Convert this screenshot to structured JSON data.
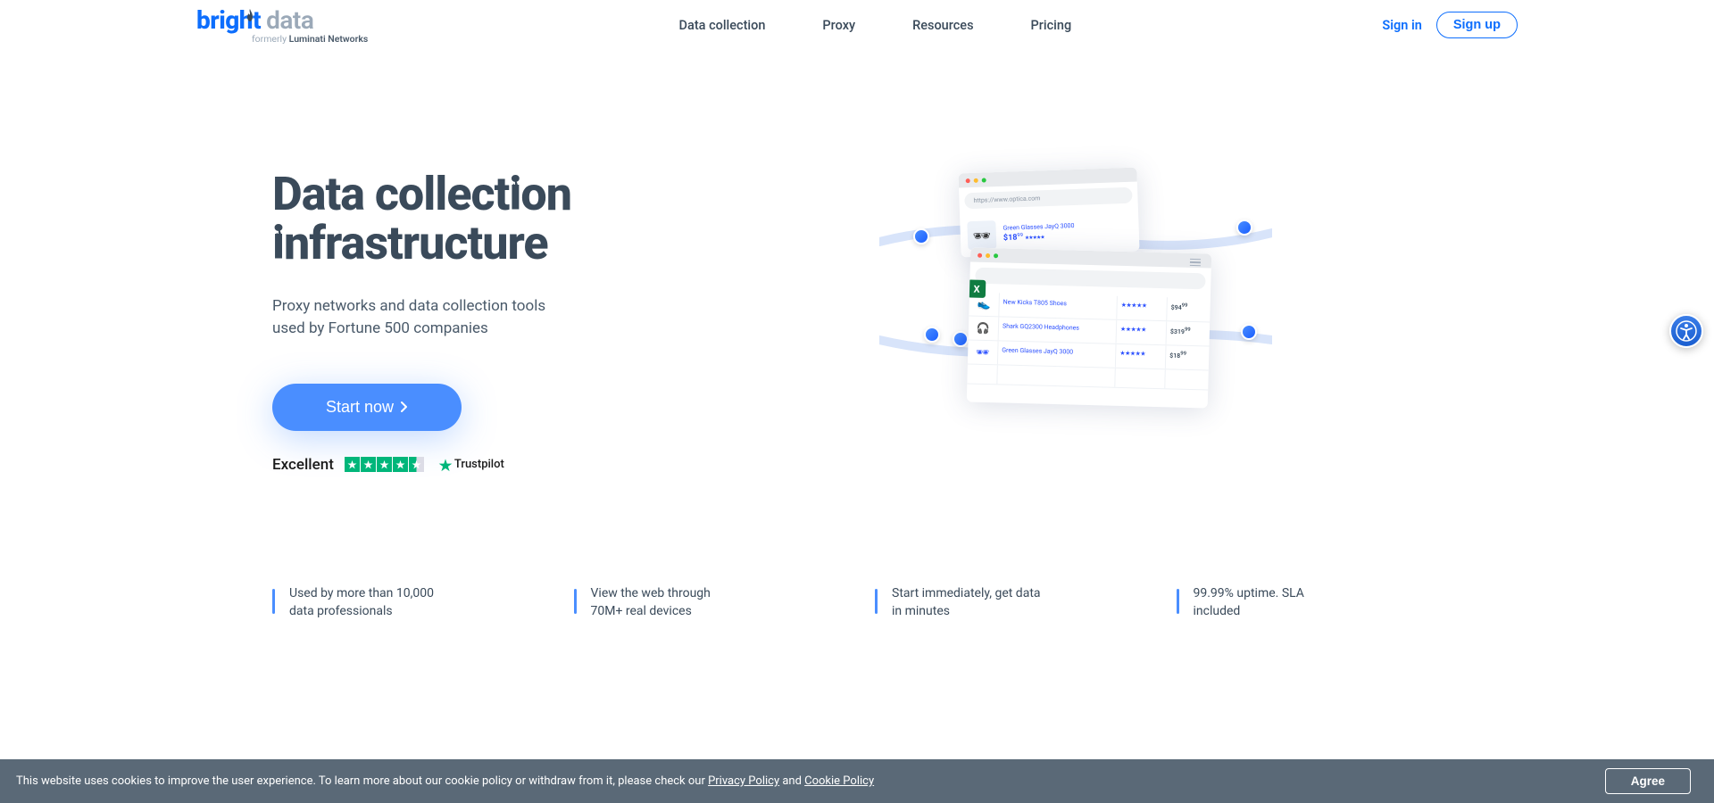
{
  "header": {
    "logo": {
      "part1": "bright",
      "part2": "data",
      "sub_prefix": "formerly",
      "sub_name": "Luminati Networks"
    },
    "nav": [
      "Data collection",
      "Proxy",
      "Resources",
      "Pricing"
    ],
    "signin": "Sign in",
    "signup": "Sign up"
  },
  "hero": {
    "title_line1": "Data collect",
    "title_line1_suffix": "on",
    "title_line2_prefix": "",
    "title_line2": "nfrastructure",
    "subtitle": "Proxy networks and data collection tools used by Fortune 500 companies",
    "cta": "Start now",
    "trust_label": "Excellent",
    "trust_brand": "Trustpilot"
  },
  "illustration": {
    "url1": "https://www.optica.com",
    "card1": {
      "name": "Green Glasses JayQ 3000",
      "price": "$18",
      "cents": "99"
    },
    "rows": [
      {
        "icon": "👟",
        "name": "New Kicks T805 Shoes",
        "stars": "★★★★★",
        "price": "$94",
        "cents": "99"
      },
      {
        "icon": "🎧",
        "name": "Shark GQ2300 Headphones",
        "stars": "★★★★★",
        "price": "$319",
        "cents": "99"
      },
      {
        "icon": "🕶",
        "name": "Green Glasses JayQ 3000",
        "stars": "★★★★★",
        "price": "$18",
        "cents": "99"
      }
    ],
    "excel": "X"
  },
  "benefits": [
    "Used by more than 10,000 data professionals",
    "View the web through 70M+ real devices",
    "Start immediately, get data in minutes",
    "99.99% uptime. SLA included"
  ],
  "cookie": {
    "text_prefix": "This website uses cookies to improve the user experience. To learn more about our cookie policy or withdraw from it, please check our ",
    "privacy": "Privacy Policy",
    "and": " and ",
    "cookie_policy": "Cookie Policy",
    "agree": "Agree"
  }
}
